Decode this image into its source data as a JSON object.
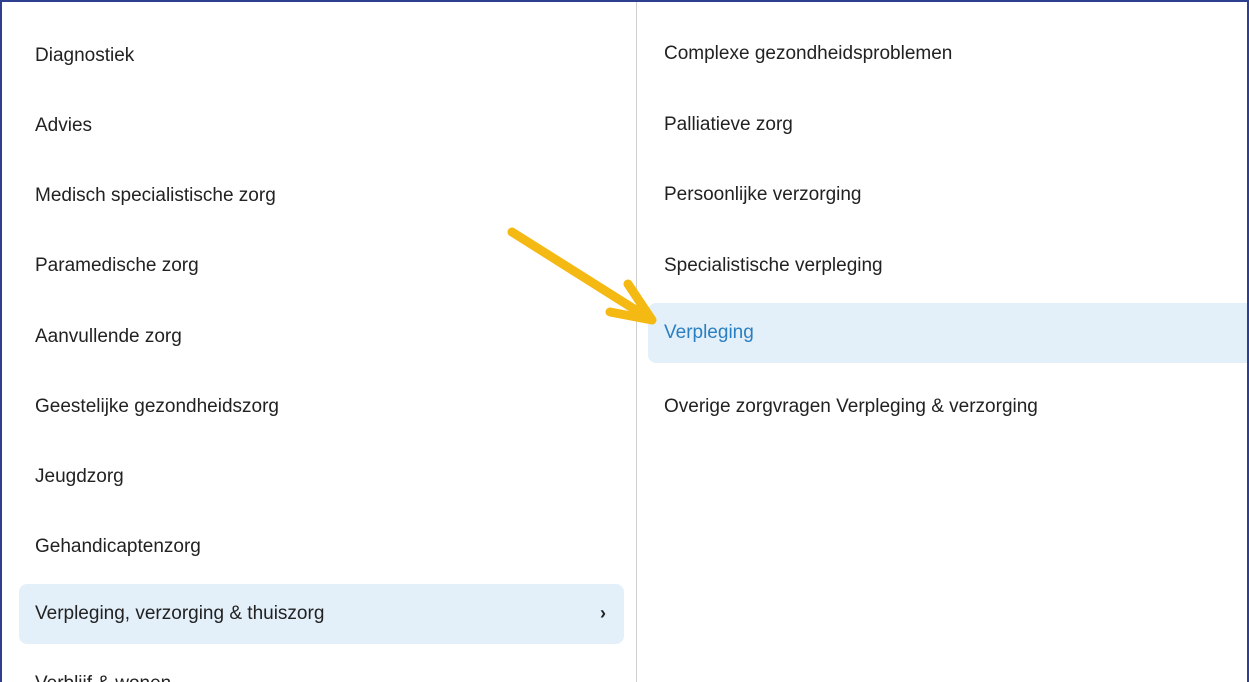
{
  "left_menu": {
    "items": [
      {
        "label": "Diagnostiek"
      },
      {
        "label": "Advies"
      },
      {
        "label": "Medisch specialistische zorg"
      },
      {
        "label": "Paramedische zorg"
      },
      {
        "label": "Aanvullende zorg"
      },
      {
        "label": "Geestelijke gezondheidszorg"
      },
      {
        "label": "Jeugdzorg"
      },
      {
        "label": "Gehandicaptenzorg"
      },
      {
        "label": "Verpleging, verzorging & thuiszorg",
        "selected": true,
        "chevron": "›"
      },
      {
        "label": "Verblijf & wonen"
      }
    ]
  },
  "right_menu": {
    "items": [
      {
        "label": "Complexe gezondheidsproblemen"
      },
      {
        "label": "Palliatieve zorg"
      },
      {
        "label": "Persoonlijke verzorging"
      },
      {
        "label": "Specialistische verpleging"
      },
      {
        "label": "Verpleging",
        "selected": true
      },
      {
        "label": "Overige zorgvragen Verpleging & verzorging"
      }
    ]
  },
  "colors": {
    "frame_border": "#2f3f8f",
    "active_bg": "#e3f0fa",
    "active_text": "#2a7fc0",
    "annotation_arrow": "#f5b914"
  },
  "icons": {
    "chevron": "chevron-right-icon",
    "annotation": "arrow-annotation-icon"
  }
}
